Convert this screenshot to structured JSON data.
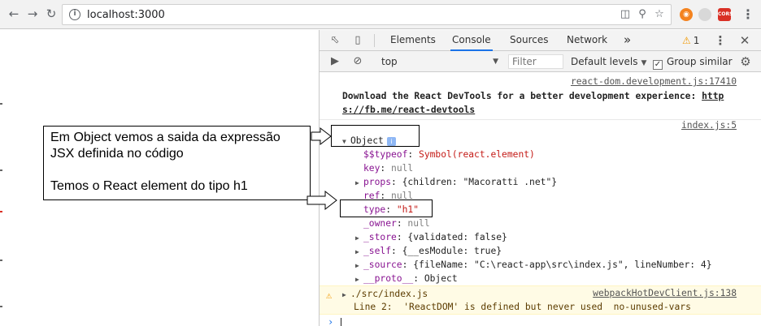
{
  "browser": {
    "url": "localhost:3000",
    "back_icon": "arrow-left-icon",
    "forward_icon": "arrow-right-icon",
    "reload_icon": "reload-icon",
    "extensions": [
      {
        "name": "orange-extension-icon",
        "color": "#f4831f",
        "label": ""
      },
      {
        "name": "gray-extension-icon",
        "color": "#cfcfcf",
        "label": ""
      },
      {
        "name": "cors-extension-icon",
        "color": "#d93025",
        "label": "CORS"
      }
    ]
  },
  "devtools": {
    "tabs": [
      {
        "label": "Elements",
        "active": false
      },
      {
        "label": "Console",
        "active": true
      },
      {
        "label": "Sources",
        "active": false
      },
      {
        "label": "Network",
        "active": false
      }
    ],
    "more_tabs": "»",
    "warning_count": "1",
    "context": "top",
    "filter_placeholder": "Filter",
    "levels": "Default levels",
    "group_similar": "Group similar",
    "group_similar_checked": true
  },
  "console": {
    "msg1_source": "react-dom.development.js:17410",
    "msg1_line1": "Download the React DevTools for a better development experience: ",
    "msg1_link1": "http",
    "msg1_link2": "s://fb.me/react-devtools",
    "msg2_source": "index.js:5",
    "object_label": "Object",
    "fields": [
      {
        "key": "$$typeof",
        "value": "Symbol(react.element)",
        "value_class": "str",
        "expandable": false
      },
      {
        "key": "key",
        "value": "null",
        "value_class": "gray",
        "expandable": false
      },
      {
        "key": "props",
        "value": "{children: \"Macoratti .net\"}",
        "value_class": "mixed",
        "expandable": true
      },
      {
        "key": "ref",
        "value": "null",
        "value_class": "gray",
        "expandable": false
      },
      {
        "key": "type",
        "value": "\"h1\"",
        "value_class": "str",
        "expandable": false
      },
      {
        "key": "_owner",
        "value": "null",
        "value_class": "gray",
        "expandable": false
      },
      {
        "key": "_store",
        "value": "{validated: false}",
        "value_class": "mixed",
        "expandable": true
      },
      {
        "key": "_self",
        "value": "{__esModule: true}",
        "value_class": "mixed",
        "expandable": true
      },
      {
        "key": "_source",
        "value": "{fileName: \"C:\\react-app\\src\\index.js\", lineNumber: 4}",
        "value_class": "mixed",
        "expandable": true
      },
      {
        "key": "__proto__",
        "value": "Object",
        "value_class": "plain",
        "expandable": true
      }
    ],
    "warn_source": "webpackHotDevClient.js:138",
    "warn_line1": "./src/index.js",
    "warn_line2": "Line 2:  'ReactDOM' is defined but never used  no-unused-vars"
  },
  "annotation": {
    "line1": "Em Object vemos a saida da expressão",
    "line2": "JSX definida no código",
    "line3": "Temos o React element do tipo h1"
  }
}
